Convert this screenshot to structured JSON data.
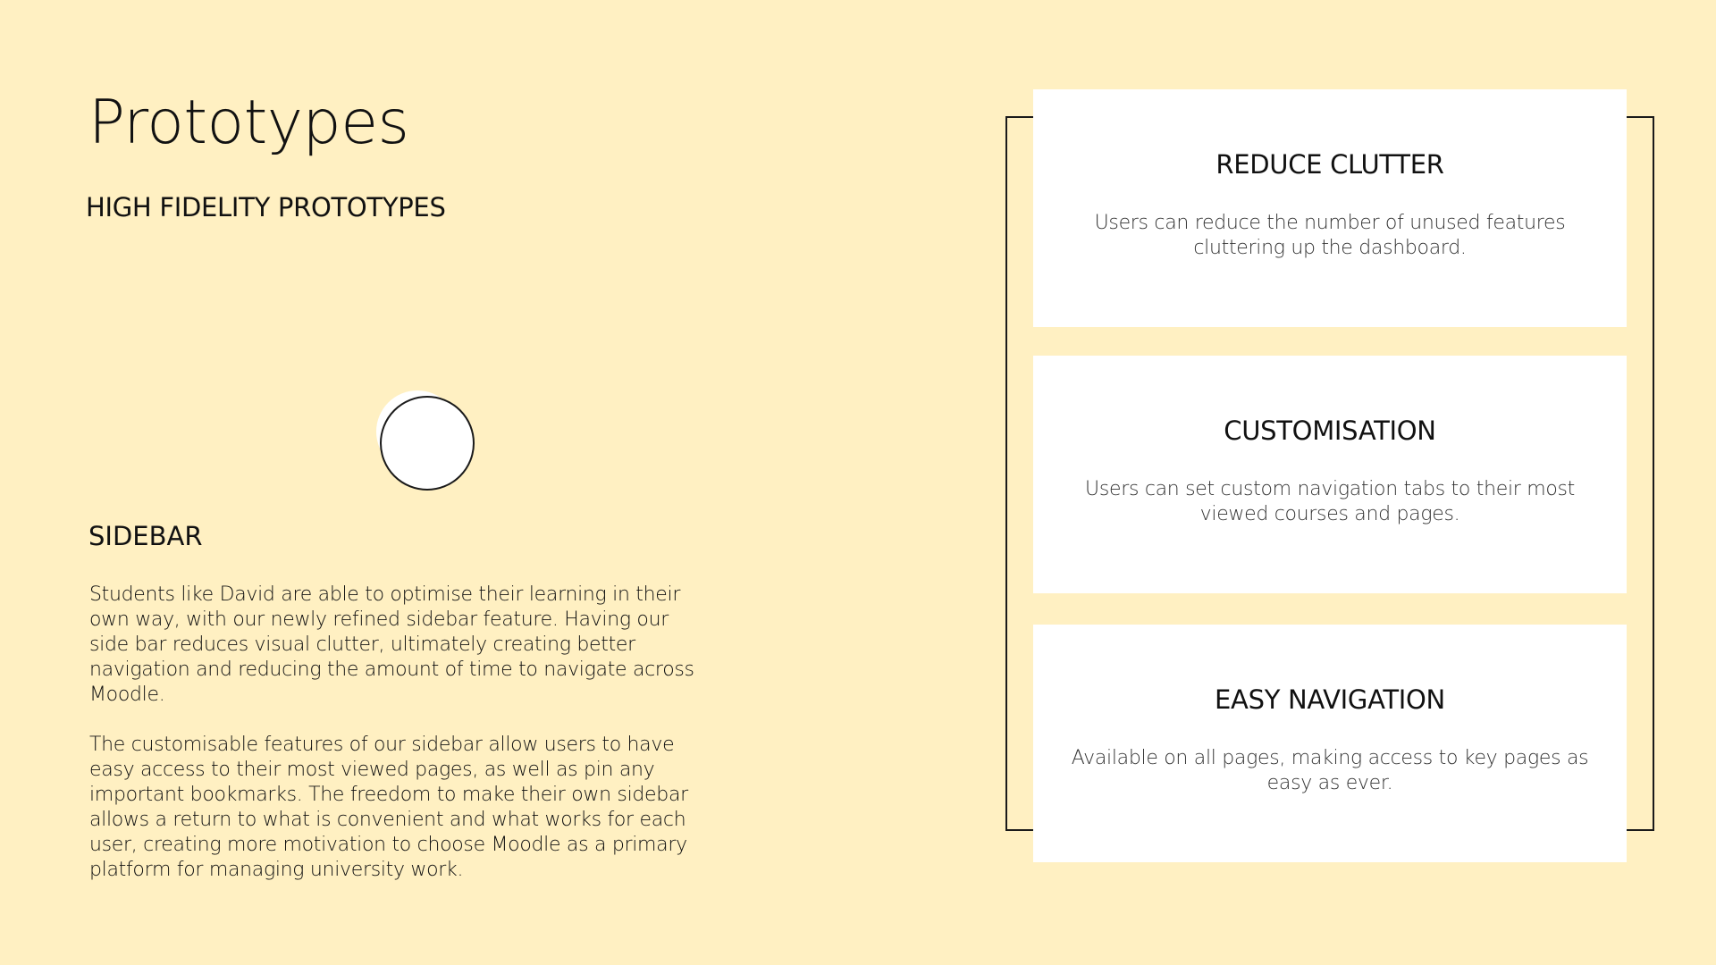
{
  "theme": {
    "background": "#FFF0C2",
    "card_background": "#FFFFFF",
    "text_color": "#111111",
    "line_color": "#1A1A1A"
  },
  "slide": {
    "title": "Prototypes",
    "subtitle": "HIGH FIDELITY PROTOTYPES",
    "section_heading": "SIDEBAR",
    "paragraphs": [
      "Students like David are able to optimise their learning in their own way, with our newly refined sidebar feature. Having our side bar reduces visual clutter, ultimately creating better navigation and reducing the amount of time to navigate across Moodle.",
      "The customisable features of our sidebar allow users to have easy access to their most viewed pages, as well as pin any important bookmarks. The freedom to make their own sidebar allows a return to what is convenient and what works for each user, creating more motivation to choose Moodle as a primary platform for managing university work."
    ]
  },
  "cards": [
    {
      "title": "REDUCE CLUTTER",
      "description": "Users can reduce the number of unused features cluttering up the dashboard."
    },
    {
      "title": "CUSTOMISATION",
      "description": "Users can set custom navigation tabs to their most viewed courses and pages."
    },
    {
      "title": "EASY NAVIGATION",
      "description": "Available on all pages, making access to key pages as easy as ever."
    }
  ]
}
